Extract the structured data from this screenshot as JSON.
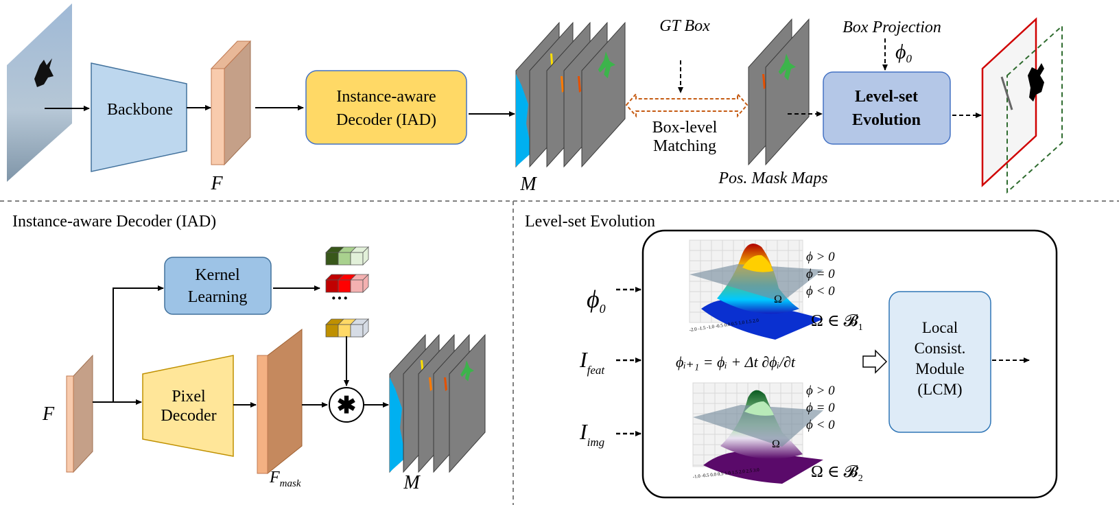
{
  "top": {
    "backbone_label": "Backbone",
    "feature_label": "F",
    "iad_line1": "Instance-aware",
    "iad_line2": "Decoder (IAD)",
    "mask_label": "M",
    "gt_box_label": "GT Box",
    "matching_line1": "Box-level",
    "matching_line2": "Matching",
    "pos_mask_label": "Pos. Mask Maps",
    "box_projection_label": "Box Projection",
    "phi0_symbol": "ϕ",
    "phi0_sub": "0",
    "lse_line1": "Level-set",
    "lse_line2": "Evolution"
  },
  "iad_panel": {
    "title": "Instance-aware Decoder (IAD)",
    "kernel_line1": "Kernel",
    "kernel_line2": "Learning",
    "ellipsis": "···",
    "pixel_line1": "Pixel",
    "pixel_line2": "Decoder",
    "feature_label": "F",
    "fmask_label": "F",
    "fmask_sub": "mask",
    "conv_symbol": "✱",
    "mask_label": "M"
  },
  "lse_panel": {
    "title": "Level-set Evolution",
    "input_phi": "ϕ",
    "input_phi_sub": "0",
    "input_feat": "I",
    "input_feat_sub": "feat",
    "input_img": "I",
    "input_img_sub": "img",
    "phi_pos": "ϕ > 0",
    "phi_zero": "ϕ = 0",
    "phi_neg": "ϕ < 0",
    "omega": "Ω",
    "omega_b1": "Ω ∈ 𝓑",
    "omega_b1_sub": "1",
    "omega_b2": "Ω ∈ 𝓑",
    "omega_b2_sub": "2",
    "equation": "ϕᵢ₊₁ = ϕᵢ + Δt ∂ϕᵢ/∂t",
    "plot1_xticks": "-2.0 -1.5 -1.0 -0.5 0.0 0.5 1.0 1.5 2.0",
    "plot2_xticks": "-1.0 -0.5 0.0 0.5 1.0 1.5 2.0 2.5 3.0",
    "lcm_line1": "Local",
    "lcm_line2": "Consist.",
    "lcm_line3": "Module",
    "lcm_line4": "(LCM)"
  },
  "colors": {
    "backbone": "#bdd7ee",
    "iad_box": "#ffd966",
    "lse_box": "#b4c7e7",
    "kernel_box": "#9dc3e6",
    "pixel_decoder": "#ffe699",
    "lcm_box": "#deebf7",
    "feature_front": "#f8cbad",
    "feature_side": "#c5a088",
    "mask_plane": "#7f7f7f",
    "matching_arrow": "#c55a11"
  }
}
